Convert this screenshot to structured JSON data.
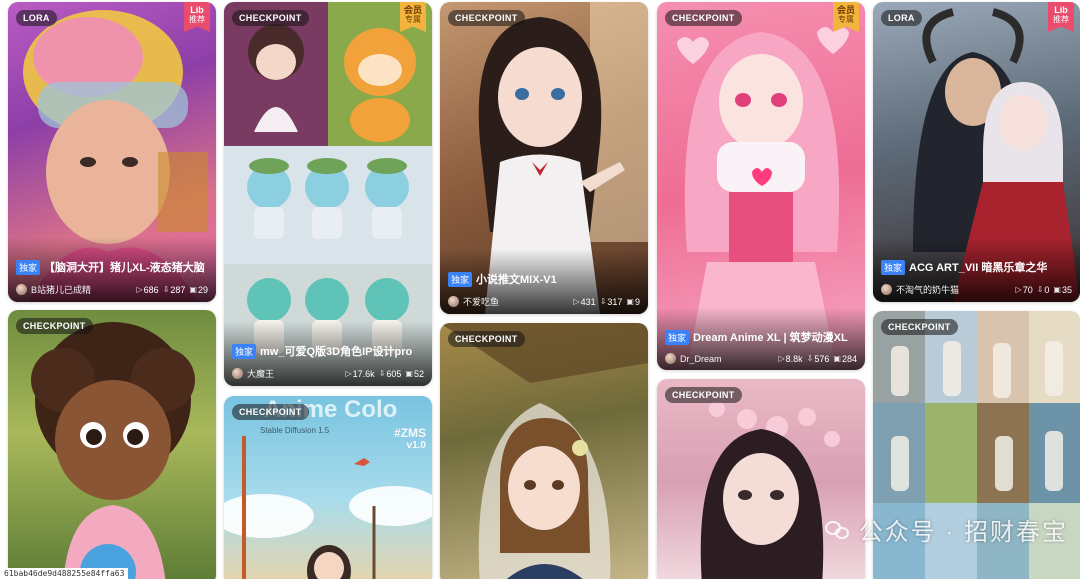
{
  "cards": [
    {
      "type": "LORA",
      "ribbon": [
        "Lib",
        "推荐"
      ],
      "exclusive": "独家",
      "title": "【脑洞大开】猪儿XL-液态猪大脑",
      "author": "B站猪儿已成精",
      "stats": [
        "686",
        "287",
        "29"
      ]
    },
    {
      "type": "CHECKPOINT",
      "ribbon": [
        "会员",
        "专属"
      ],
      "exclusive": "独家",
      "title": "mw_可爱Q版3D角色IP设计pro",
      "author": "大魔王",
      "stats": [
        "17.6k",
        "605",
        "52"
      ]
    },
    {
      "type": "CHECKPOINT",
      "exclusive": "独家",
      "title": "小说推文MIX-V1",
      "author": "不爱吃鱼",
      "stats": [
        "431",
        "317",
        "9"
      ]
    },
    {
      "type": "CHECKPOINT",
      "ribbon": [
        "会员",
        "专属"
      ],
      "exclusive": "独家",
      "title": "Dream Anime XL | 筑梦动漫XL",
      "author": "Dr_Dream",
      "stats": [
        "8.8k",
        "576",
        "284"
      ]
    },
    {
      "type": "LORA",
      "ribbon": [
        "Lib",
        "推荐"
      ],
      "exclusive": "独家",
      "title": "ACG ART_VII 暗黑乐章之华",
      "author": "不淘气的奶牛猫",
      "stats": [
        "70",
        "0",
        "35"
      ]
    },
    {
      "type": "CHECKPOINT"
    },
    {
      "type": "CHECKPOINT",
      "overlay": "Anime Colo",
      "overlay_sub": "Stable Diffusion 1.5",
      "badge": "#ZMS",
      "badge_ver": "v1.0"
    },
    {
      "type": "CHECKPOINT"
    },
    {
      "type": "CHECKPOINT"
    },
    {
      "type": "CHECKPOINT"
    }
  ],
  "watermark": "公众号 · 招财春宝",
  "hash": "61bab46de9d488255e84ffa63",
  "stat_icons": [
    "play-icon",
    "download-icon",
    "image-icon"
  ],
  "colors": {
    "exclusive": "#3b82f6",
    "lib_ribbon": "#e94c6d",
    "vip_ribbon": "#f3b43d"
  }
}
